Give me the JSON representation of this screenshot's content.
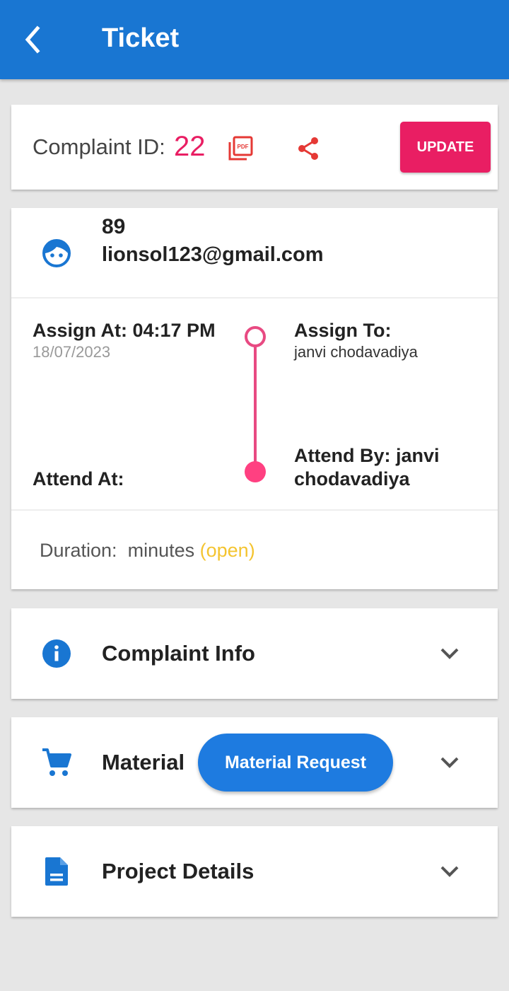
{
  "appbar": {
    "title": "Ticket",
    "color": "#1976d2"
  },
  "complaint": {
    "id_label": "Complaint ID:",
    "id_value": "22",
    "pdf_icon": "pdf-icon",
    "share_icon": "share-icon",
    "update_label": "UPDATE"
  },
  "user": {
    "number": "89",
    "email": "lionsol123@gmail.com",
    "icon": "face-icon"
  },
  "timeline": {
    "assign_at": "Assign At: 04:17 PM",
    "assign_date": "18/07/2023",
    "attend_at": "Attend At:",
    "assign_to": "Assign To:",
    "assign_to_name": "janvi chodavadiya",
    "attend_by": "Attend By: janvi chodavadiya"
  },
  "duration": {
    "label": "Duration:",
    "value": "minutes",
    "status": "(open)"
  },
  "sections": [
    {
      "title": "Complaint Info",
      "icon": "info-icon"
    },
    {
      "title": "Material",
      "icon": "cart-icon",
      "button": "Material Request"
    },
    {
      "title": "Project Details",
      "icon": "document-icon"
    }
  ],
  "colors": {
    "accent": "#e91e63",
    "primary": "#1976d2",
    "open_status": "#f4c430"
  }
}
